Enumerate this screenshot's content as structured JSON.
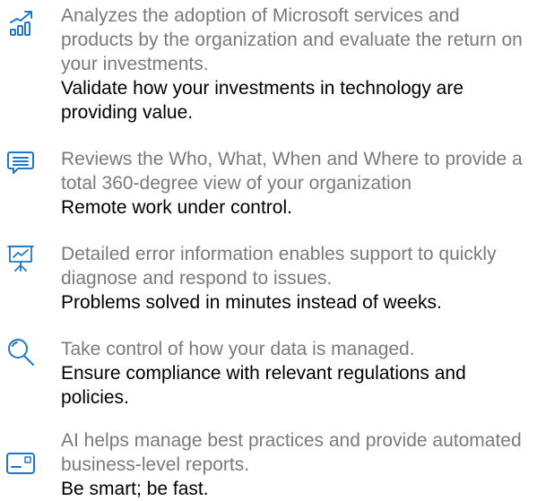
{
  "colors": {
    "accent": "#1f77c9",
    "description": "#7a7a7a",
    "tagline": "#000000",
    "background": "#ffffff"
  },
  "features": [
    {
      "icon": "growth-chart-icon",
      "description": "Analyzes the adoption of Microsoft services and products by the organization and evaluate the return on your investments.",
      "tagline": "Validate how your investments in technology are providing value."
    },
    {
      "icon": "chat-message-icon",
      "description": "Reviews the Who, What, When and Where to provide a total 360-degree view of your organization",
      "tagline": "Remote work under control."
    },
    {
      "icon": "presentation-board-icon",
      "description": "Detailed error information enables support to quickly diagnose and respond to issues.",
      "tagline": "Problems solved in minutes instead of weeks."
    },
    {
      "icon": "magnifier-icon",
      "description": "Take control of how your data is managed.",
      "tagline": "Ensure compliance with relevant regulations and policies."
    },
    {
      "icon": "report-card-icon",
      "description": "AI helps manage best practices and provide automated business-level reports.",
      "tagline": "Be smart; be fast."
    }
  ]
}
